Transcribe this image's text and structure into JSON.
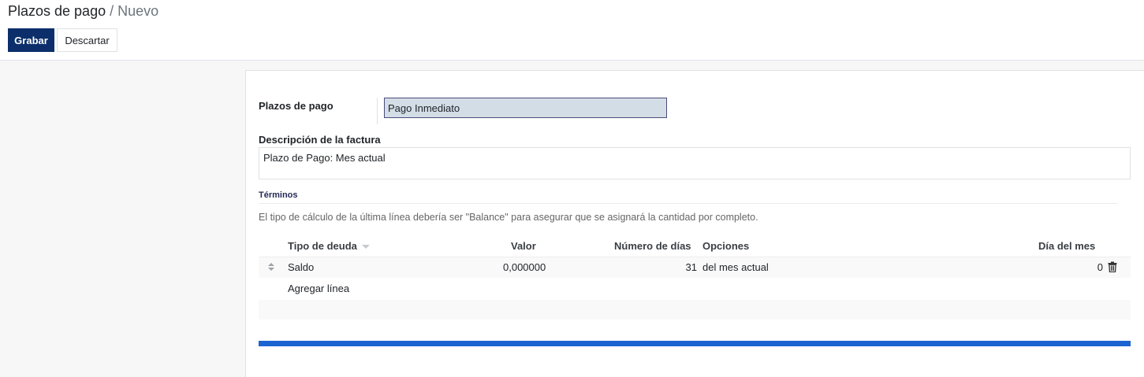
{
  "breadcrumb": {
    "parent": "Plazos de pago",
    "separator": "/",
    "current": "Nuevo"
  },
  "actions": {
    "save_label": "Grabar",
    "discard_label": "Descartar"
  },
  "form": {
    "name_label": "Plazos de pago",
    "name_value": "Pago Inmediato",
    "description_label": "Descripción de la factura",
    "description_value": "Plazo de Pago: Mes actual",
    "terms_section_title": "Términos",
    "terms_note": "El tipo de cálculo de la última línea debería ser \"Balance\" para asegurar que se asignará la cantidad por completo."
  },
  "table": {
    "columns": [
      "Tipo de deuda",
      "Valor",
      "Número de días",
      "Opciones",
      "Día del mes"
    ],
    "rows": [
      {
        "debt_type": "Saldo",
        "value": "0,000000",
        "days": "31",
        "options": "del mes actual",
        "day_of_month": "0"
      }
    ],
    "add_line_label": "Agregar línea"
  },
  "icons": {
    "sort": "caret-down-icon",
    "handle": "drag-handle-icon",
    "delete": "trash-icon"
  },
  "colors": {
    "primary": "#0c2f6b",
    "input_highlight": "#d3dde6",
    "progress": "#1c64d1",
    "section_title": "#262a57"
  }
}
